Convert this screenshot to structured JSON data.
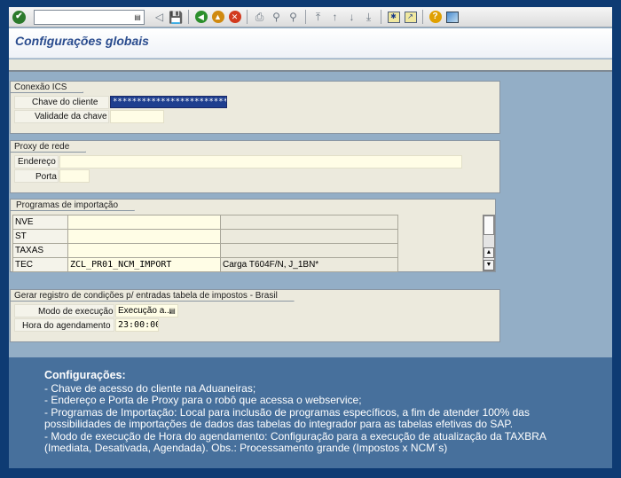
{
  "toolbar": {
    "command_field_value": ""
  },
  "title": "Configurações globais",
  "conexao": {
    "group_title": "Conexão ICS",
    "chave_label": "Chave do cliente",
    "chave_value": "**************************",
    "validade_label": "Validade da chave",
    "validade_value": ""
  },
  "proxy": {
    "group_title": "Proxy de rede",
    "endereco_label": "Endereço",
    "endereco_value": "",
    "porta_label": "Porta",
    "porta_value": ""
  },
  "programas": {
    "group_title": "Programas de importação",
    "rows": [
      {
        "key": "NVE",
        "program": "",
        "desc": ""
      },
      {
        "key": "ST",
        "program": "",
        "desc": ""
      },
      {
        "key": "TAXAS",
        "program": "",
        "desc": ""
      },
      {
        "key": "TEC",
        "program": "ZCL_PR01_NCM_IMPORT",
        "desc": "Carga T604F/N, J_1BN*"
      }
    ]
  },
  "registro": {
    "group_title": "Gerar registro de condições p/ entradas tabela de impostos - Brasil",
    "modo_label": "Modo de execução",
    "modo_value": "Execução a...",
    "hora_label": "Hora do agendamento",
    "hora_value": "23:00:00"
  },
  "info": {
    "heading": "Configurações:",
    "lines": [
      "-   Chave de acesso do cliente na Aduaneiras;",
      "-   Endereço e Porta de Proxy para o robô que acessa o webservice;",
      "-   Programas de Importação: Local para inclusão de programas específicos, a fim de atender 100% das possibilidades de importações de dados das tabelas do integrador para as tabelas efetivas do SAP.",
      "-   Modo de execução de Hora do agendamento: Configuração para a execução de atualização da TAXBRA (Imediata, Desativada, Agendada). Obs.: Processamento grande (Impostos x NCM´s)"
    ]
  }
}
